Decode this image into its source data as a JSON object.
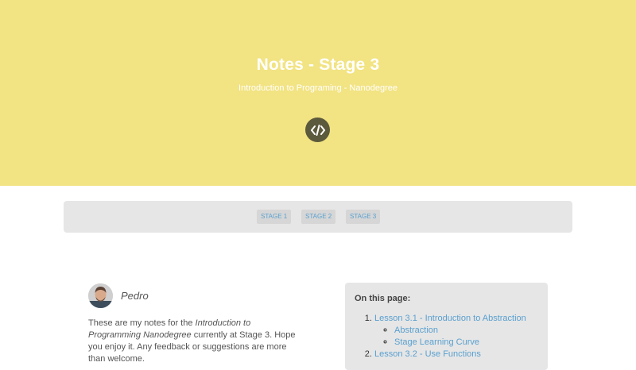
{
  "hero": {
    "title": "Notes - Stage 3",
    "subtitle": "Introduction to Programing - Nanodegree",
    "icon": "code-icon",
    "background": "#f2e383"
  },
  "nav": {
    "items": [
      {
        "label": "STAGE 1"
      },
      {
        "label": "STAGE 2"
      },
      {
        "label": "STAGE 3"
      }
    ]
  },
  "author": {
    "name": "Pedro"
  },
  "intro": {
    "before": "These are my notes for the ",
    "course": "Introduction to Programming Nanodegree",
    "after": " currently at Stage 3. Hope you enjoy it. Any feedback or suggestions are more than welcome."
  },
  "toc": {
    "heading": "On this page:",
    "lessons": [
      {
        "label": "Lesson 3.1 - Introduction to Abstraction",
        "subitems": [
          {
            "label": "Abstraction"
          },
          {
            "label": "Stage Learning Curve"
          }
        ]
      },
      {
        "label": "Lesson 3.2 - Use Functions"
      }
    ]
  },
  "colors": {
    "link": "#5aa0cf",
    "panel": "#e6e6e6"
  }
}
